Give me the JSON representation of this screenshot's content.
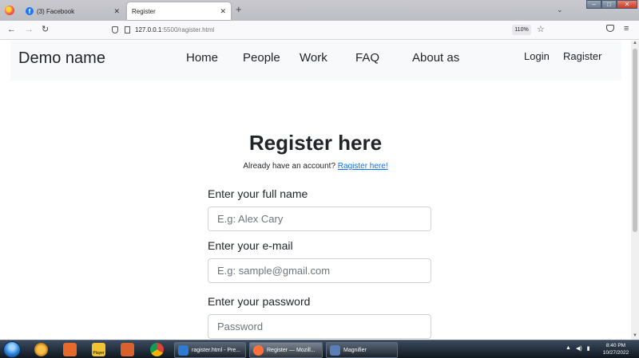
{
  "browser": {
    "tabs": [
      {
        "title": "(3) Facebook",
        "icon": "facebook-icon"
      },
      {
        "title": "Register",
        "icon": "none"
      }
    ],
    "url_host": "127.0.0.1",
    "url_rest": ":5500/ragister.html",
    "zoom": "110%"
  },
  "site_nav": {
    "brand": "Demo name",
    "links": [
      "Home",
      "People",
      "Work",
      "FAQ",
      "About as"
    ],
    "login": "Login",
    "register": "Ragister"
  },
  "register": {
    "title": "Register here",
    "have_account": "Already have an account?",
    "have_account_link": "Ragister here!",
    "fields": [
      {
        "label": "Enter your full name",
        "placeholder": "E.g: Alex Cary"
      },
      {
        "label": "Enter your e-mail",
        "placeholder": "E.g: sample@gmail.com"
      },
      {
        "label": "Enter your password",
        "placeholder": "Password"
      }
    ]
  },
  "taskbar": {
    "pinned_player_label": "Player",
    "windows": [
      {
        "title": "ragister.html - Pre...",
        "icon": "vscode-icon",
        "color": "#2f7ad2"
      },
      {
        "title": "Register — Mozill...",
        "icon": "firefox-icon",
        "color": "#ff7139"
      },
      {
        "title": "Magnifier",
        "icon": "magnifier-icon",
        "color": "#5a7fb8"
      }
    ],
    "time": "8:40 PM",
    "date": "10/27/2022"
  },
  "colors": {
    "link": "#0d6efd",
    "nav_bg": "#f8f9fa",
    "input_border": "#ced4da"
  }
}
